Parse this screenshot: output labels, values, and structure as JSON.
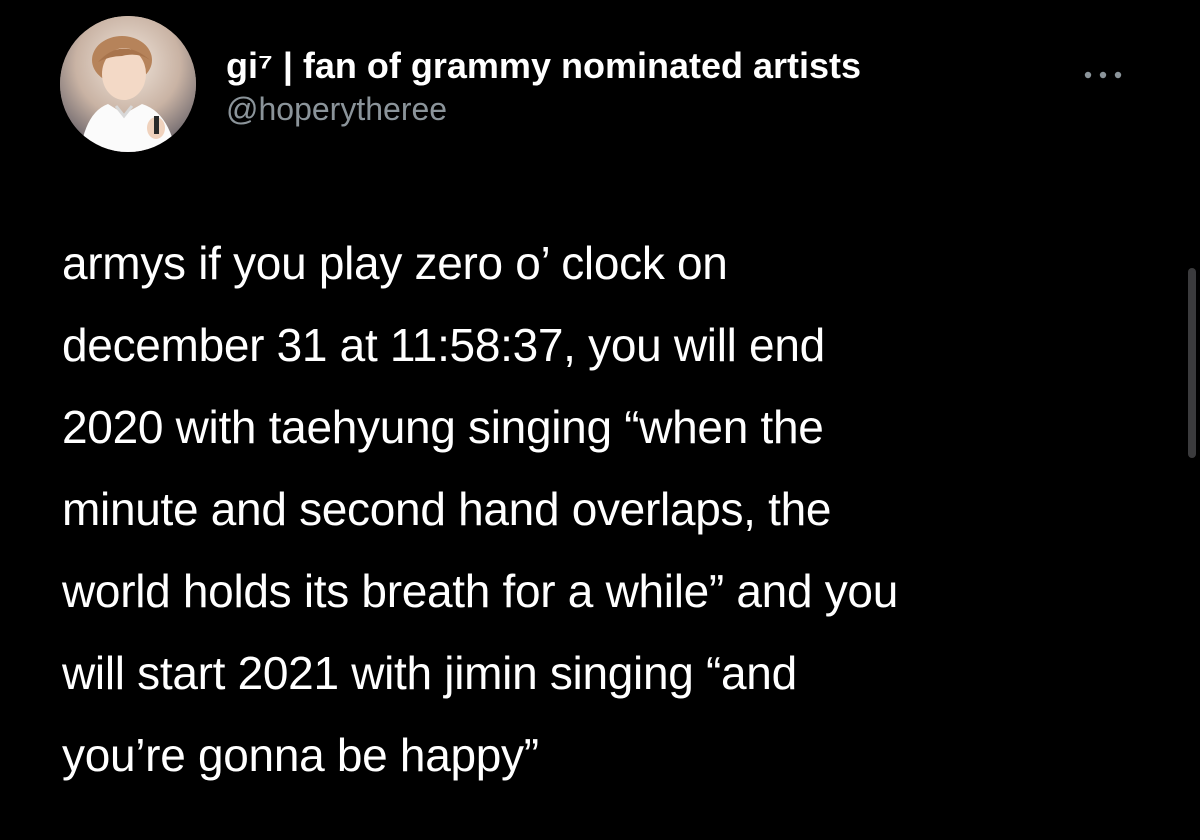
{
  "tweet": {
    "author": {
      "display_name": "gi⁷ | fan of grammy nominated artists",
      "handle": "@hoperytheree",
      "avatar_icon": "profile-photo"
    },
    "more_icon": "ellipsis-icon",
    "text": "armys if you play zero o’ clock on\ndecember 31 at 11:58:37, you will end\n2020 with taehyung singing “when the\nminute and second hand overlaps, the\nworld holds its breath for a while” and you\nwill start 2021 with jimin singing “and\nyou’re gonna be happy”"
  },
  "colors": {
    "background": "#000000",
    "text_primary": "#ffffff",
    "text_secondary": "#8b949a"
  }
}
